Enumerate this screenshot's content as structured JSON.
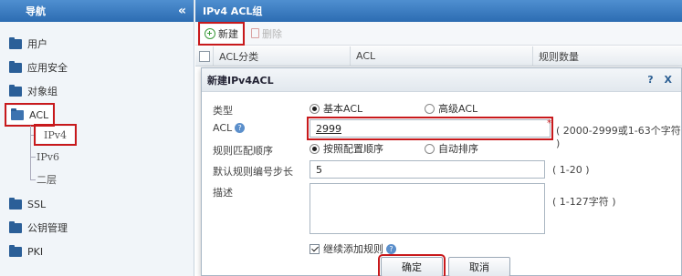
{
  "sidebar": {
    "title": "导航",
    "collapse_glyph": "«",
    "items": [
      {
        "label": "用户",
        "icon": "folder-icon"
      },
      {
        "label": "应用安全",
        "icon": "folder-icon"
      },
      {
        "label": "对象组",
        "icon": "folder-icon"
      },
      {
        "label": "ACL",
        "icon": "folder-open-icon"
      },
      {
        "label": "SSL",
        "icon": "folder-icon"
      },
      {
        "label": "公钥管理",
        "icon": "folder-icon"
      },
      {
        "label": "PKI",
        "icon": "folder-icon"
      }
    ],
    "acl_children": [
      "IPv4",
      "IPv6",
      "二层"
    ]
  },
  "main": {
    "title": "IPv4 ACL组",
    "toolbar": {
      "new_label": "新建",
      "delete_label": "删除"
    },
    "columns": [
      "ACL分类",
      "ACL",
      "规则数量"
    ]
  },
  "dialog": {
    "title": "新建IPv4ACL",
    "title_actions": "? X",
    "type_label": "类型",
    "type_options": [
      "基本ACL",
      "高级ACL"
    ],
    "type_selected": "基本ACL",
    "acl_label": "ACL",
    "help_glyph": "?",
    "acl_value": "2999",
    "required_mark": "*",
    "acl_hint": "( 2000-2999或1-63个字符 )",
    "order_label": "规则匹配顺序",
    "order_options": [
      "按照配置顺序",
      "自动排序"
    ],
    "order_selected": "按照配置顺序",
    "step_label": "默认规则编号步长",
    "step_value": "5",
    "step_hint": "( 1-20 )",
    "desc_label": "描述",
    "desc_value": "",
    "desc_hint": "( 1-127字符 )",
    "continue_label": "继续添加规则",
    "continue_checked": true,
    "ok_label": "确定",
    "cancel_label": "取消"
  },
  "colors": {
    "header": "#2c6cb2",
    "highlight": "#c8191c",
    "folder": "#2b5f98"
  }
}
